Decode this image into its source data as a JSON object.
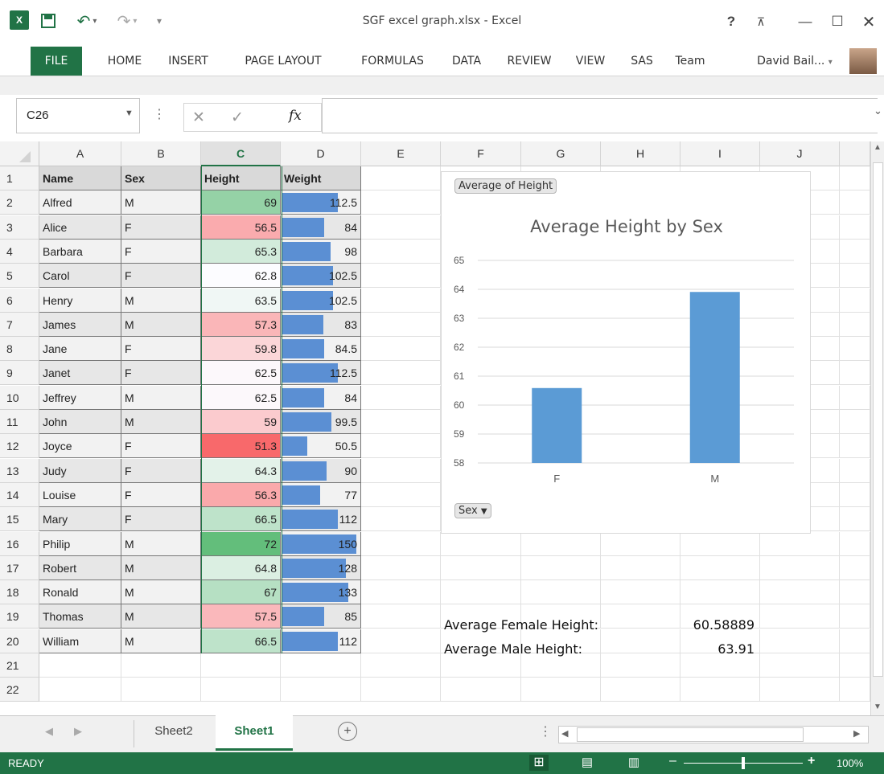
{
  "window": {
    "title": "SGF excel graph.xlsx - Excel",
    "help": "?",
    "user": "David Bail..."
  },
  "ribbon": {
    "tabs": [
      "FILE",
      "HOME",
      "INSERT",
      "PAGE LAYOUT",
      "FORMULAS",
      "DATA",
      "REVIEW",
      "VIEW",
      "SAS",
      "Team"
    ]
  },
  "formula_bar": {
    "namebox": "C26",
    "fx": "fx",
    "value": ""
  },
  "columns": [
    "A",
    "B",
    "C",
    "D",
    "E",
    "F",
    "G",
    "H",
    "I",
    "J"
  ],
  "rows": [
    "1",
    "2",
    "3",
    "4",
    "5",
    "6",
    "7",
    "8",
    "9",
    "10",
    "11",
    "12",
    "13",
    "14",
    "15",
    "16",
    "17",
    "18",
    "19",
    "20",
    "21",
    "22"
  ],
  "table": {
    "headers": [
      "Name",
      "Sex",
      "Height",
      "Weight"
    ],
    "data": [
      [
        "Alfred",
        "M",
        "69",
        "112.5"
      ],
      [
        "Alice",
        "F",
        "56.5",
        "84"
      ],
      [
        "Barbara",
        "F",
        "65.3",
        "98"
      ],
      [
        "Carol",
        "F",
        "62.8",
        "102.5"
      ],
      [
        "Henry",
        "M",
        "63.5",
        "102.5"
      ],
      [
        "James",
        "M",
        "57.3",
        "83"
      ],
      [
        "Jane",
        "F",
        "59.8",
        "84.5"
      ],
      [
        "Janet",
        "F",
        "62.5",
        "112.5"
      ],
      [
        "Jeffrey",
        "M",
        "62.5",
        "84"
      ],
      [
        "John",
        "M",
        "59",
        "99.5"
      ],
      [
        "Joyce",
        "F",
        "51.3",
        "50.5"
      ],
      [
        "Judy",
        "F",
        "64.3",
        "90"
      ],
      [
        "Louise",
        "F",
        "56.3",
        "77"
      ],
      [
        "Mary",
        "F",
        "66.5",
        "112"
      ],
      [
        "Philip",
        "M",
        "72",
        "150"
      ],
      [
        "Robert",
        "M",
        "64.8",
        "128"
      ],
      [
        "Ronald",
        "M",
        "67",
        "133"
      ],
      [
        "Thomas",
        "M",
        "57.5",
        "85"
      ],
      [
        "William",
        "M",
        "66.5",
        "112"
      ]
    ]
  },
  "chart": {
    "field_button": "Average of Height",
    "axis_button": "Sex",
    "chart_data": {
      "type": "bar",
      "title": "Average Height by Sex",
      "categories": [
        "F",
        "M"
      ],
      "values": [
        60.58889,
        63.91
      ],
      "ylim": [
        58,
        65
      ],
      "yticks": [
        "58",
        "59",
        "60",
        "61",
        "62",
        "63",
        "64",
        "65"
      ],
      "grid": true,
      "bar_color": "#5b9bd5"
    }
  },
  "summary": {
    "female_label": "Average Female Height:",
    "female_value": "60.58889",
    "male_label": "Average Male Height:",
    "male_value": "63.91"
  },
  "sheets": {
    "inactive": "Sheet2",
    "active": "Sheet1"
  },
  "status": {
    "ready": "READY",
    "zoom": "100%"
  },
  "colors": {
    "accent": "#217346",
    "databar": "#5b8fd3"
  }
}
